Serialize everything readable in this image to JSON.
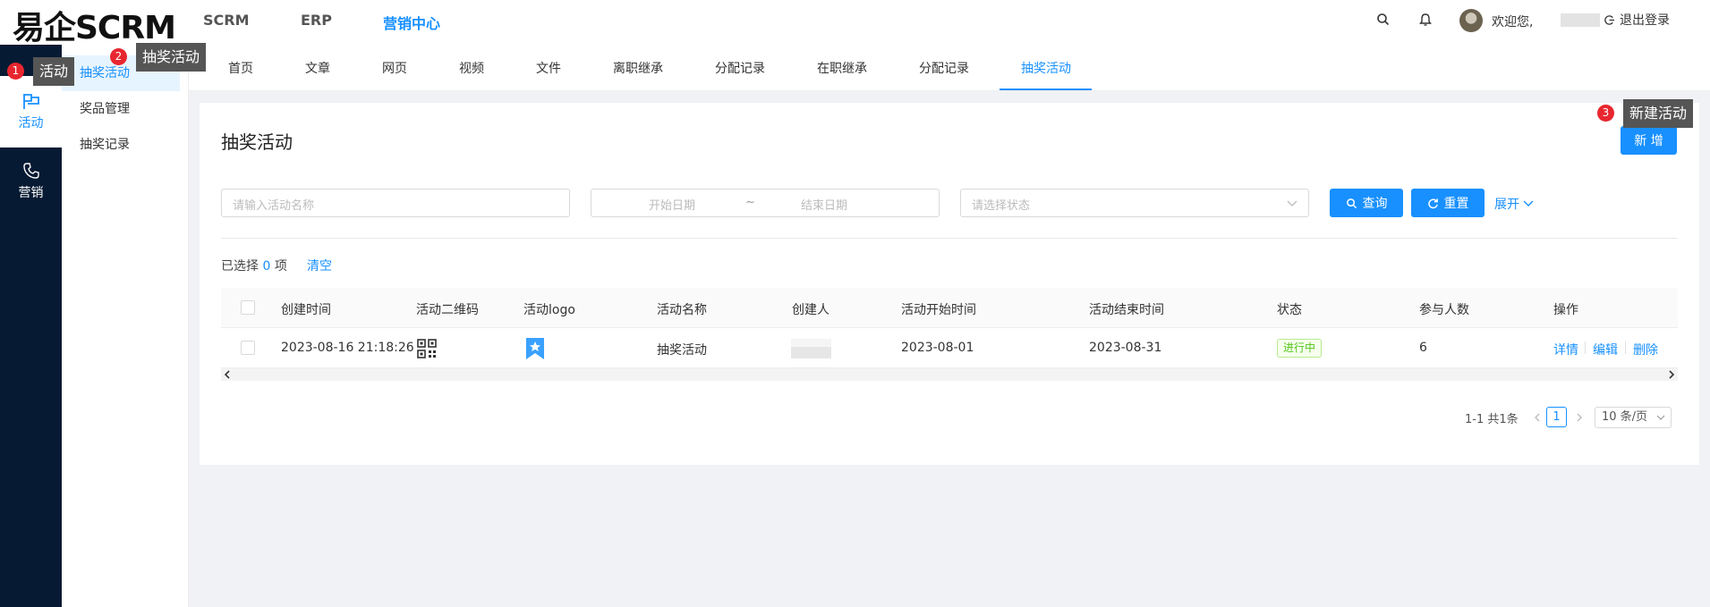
{
  "header": {
    "brand": "易企SCRM",
    "nav": [
      "SCRM",
      "ERP",
      "营销中心"
    ],
    "welcome": "欢迎您,",
    "logout": "退出登录"
  },
  "leftnav": {
    "items": [
      "活动",
      "营销"
    ]
  },
  "submenu": {
    "items": [
      "抽奖活动",
      "奖品管理",
      "抽奖记录"
    ]
  },
  "tabs": [
    "首页",
    "文章",
    "网页",
    "视频",
    "文件",
    "离职继承",
    "分配记录",
    "在职继承",
    "分配记录",
    "抽奖活动"
  ],
  "page": {
    "title": "抽奖活动",
    "new_button": "新 增",
    "search": {
      "name_placeholder": "请输入活动名称",
      "start_date_placeholder": "开始日期",
      "date_sep": "~",
      "end_date_placeholder": "结束日期",
      "status_placeholder": "请选择状态",
      "query_button": "查询",
      "reset_button": "重置",
      "expand": "展开"
    },
    "selection": {
      "prefix": "已选择",
      "count": "0",
      "suffix": "项",
      "clear": "清空"
    }
  },
  "table": {
    "columns": [
      "创建时间",
      "活动二维码",
      "活动logo",
      "活动名称",
      "创建人",
      "活动开始时间",
      "活动结束时间",
      "状态",
      "参与人数",
      "操作"
    ],
    "rows": [
      {
        "created": "2023-08-16 21:18:26",
        "name": "抽奖活动",
        "start": "2023-08-01",
        "end": "2023-08-31",
        "status": "进行中",
        "participants": "6",
        "actions": [
          "详情",
          "编辑",
          "删除"
        ]
      }
    ]
  },
  "pagination": {
    "total": "1-1 共1条",
    "current": "1",
    "page_size": "10 条/页"
  },
  "annotations": [
    {
      "num": "1",
      "label": "活动"
    },
    {
      "num": "2",
      "label": "抽奖活动"
    },
    {
      "num": "3",
      "label": "新建活动"
    }
  ],
  "colors": {
    "accent": "#1890ff",
    "sidebar": "#061a33",
    "status_green": "#52c41a"
  }
}
